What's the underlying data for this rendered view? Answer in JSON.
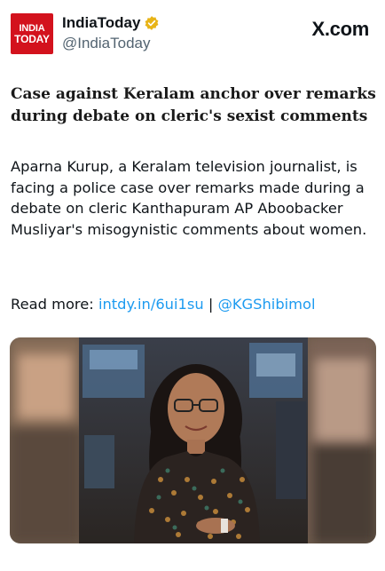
{
  "header": {
    "logo_line1": "INDIA",
    "logo_line2": "TODAY",
    "display_name": "IndiaToday",
    "handle": "@IndiaToday",
    "site": "X.com"
  },
  "post": {
    "headline": "Case against Keralam anchor over remarks during debate on cleric's sexist comments",
    "body": "Aparna Kurup, a Keralam television journalist, is facing a police case over remarks made during a debate on cleric Kanthapuram AP Aboobacker Musliyar's misogynistic comments about women.",
    "read_more_label": "Read more:",
    "link_text": "intdy.in/6ui1su",
    "separator": "|",
    "mention": "@KGShibimol"
  },
  "colors": {
    "brand_red": "#d3121d",
    "link_blue": "#1d9bf0",
    "verified_gold": "#e8b417"
  }
}
